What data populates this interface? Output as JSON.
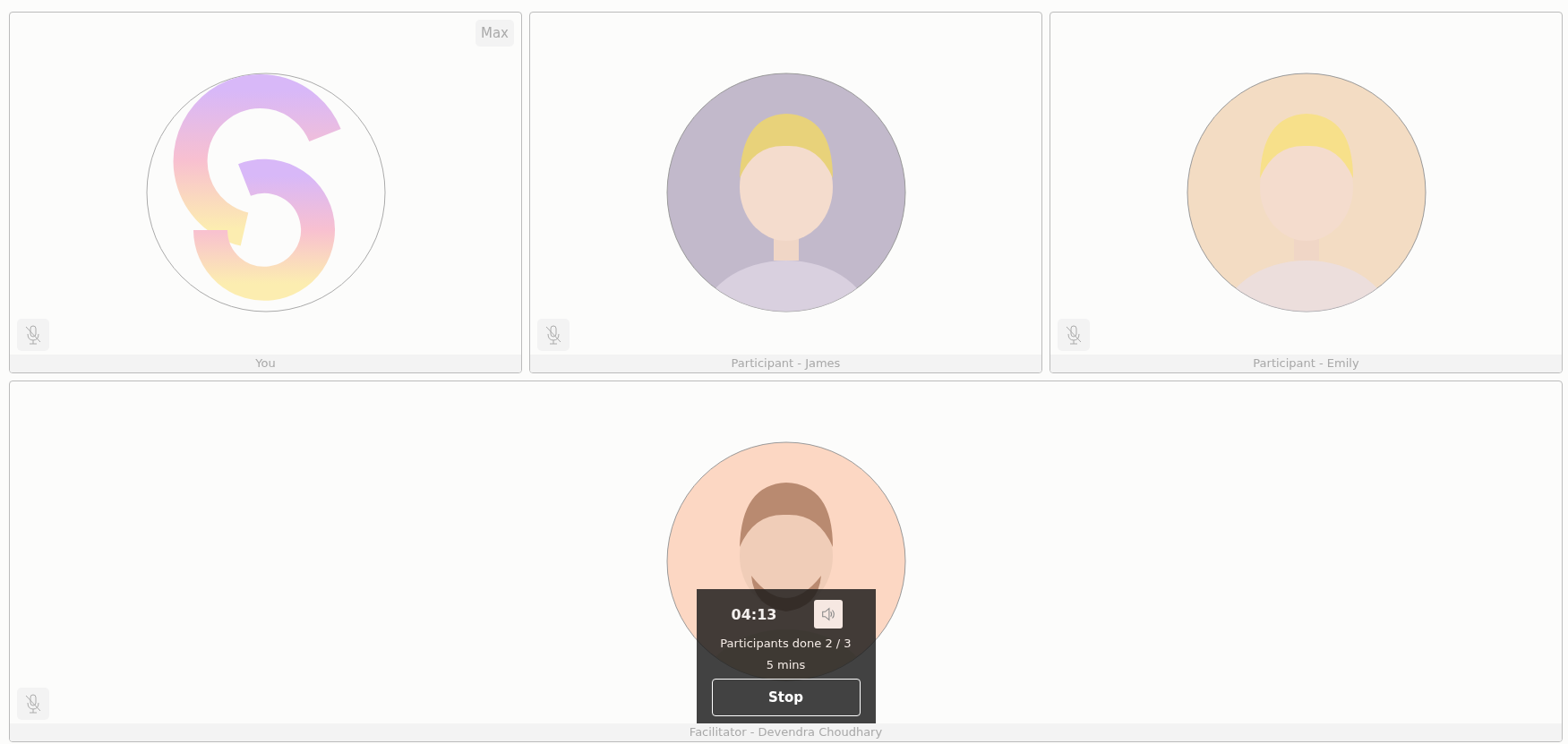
{
  "tiles": [
    {
      "label": "You",
      "kind": "logo",
      "muted": true,
      "max_button": "Max"
    },
    {
      "label": "Participant - James",
      "kind": "person",
      "color": "#c2b9cb",
      "muted": true
    },
    {
      "label": "Participant - Emily",
      "kind": "person",
      "color": "#f3dcc3",
      "muted": true
    }
  ],
  "facilitator": {
    "label": "Facilitator - Devendra Choudhary",
    "kind": "person",
    "color": "#fcd7c3",
    "muted": true
  },
  "timer": {
    "time": "04:13",
    "sound_on": true,
    "progress": "Participants done 2 / 3",
    "duration": "5 mins",
    "button": "Stop"
  }
}
